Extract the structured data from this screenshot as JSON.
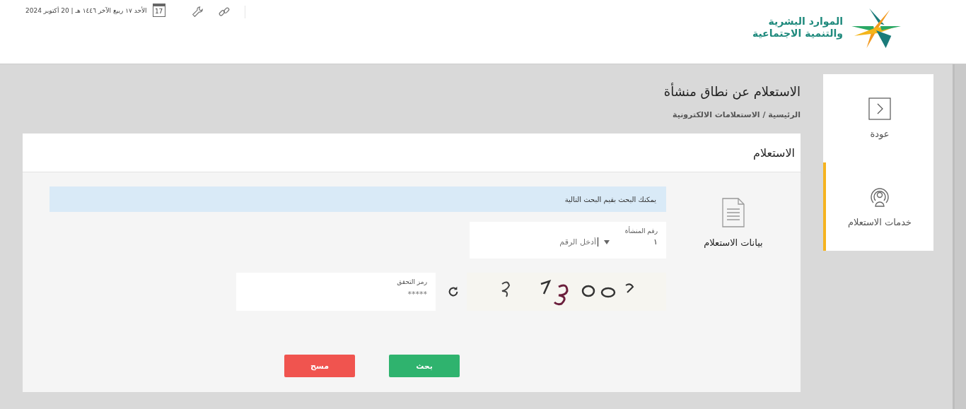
{
  "header": {
    "logo_lines": [
      "الموارد البشرية",
      "والتنمية الاجتماعية"
    ],
    "calendar_day": "17",
    "date": "الأحد ١٧ ربيع الآخر ١٤٤٦ هـ | 20 أكتوبر 2024"
  },
  "sidebar": {
    "items": [
      {
        "kind": "back",
        "label": "عودة",
        "selected": false
      },
      {
        "kind": "services",
        "label": "خدمات الاستعلام",
        "selected": true
      }
    ]
  },
  "page": {
    "title": "الاستعلام عن نطاق منشأة",
    "breadcrumb": "الرئيسية / الاستعلامات الالكترونية"
  },
  "card": {
    "title": "الاستعلام",
    "section_label": "بيانات الاستعلام",
    "info": "يمكنك البحث بقيم البحث التالية",
    "number_field": {
      "label": "رقم المنشأة",
      "prefix": "١",
      "placeholder": "أدخل الرقم"
    },
    "code_field": {
      "label": "رمز التحقق",
      "placeholder": "*****"
    },
    "buttons": [
      {
        "kind": "primary",
        "label": "بحث"
      },
      {
        "kind": "danger",
        "label": "مسح"
      }
    ]
  }
}
